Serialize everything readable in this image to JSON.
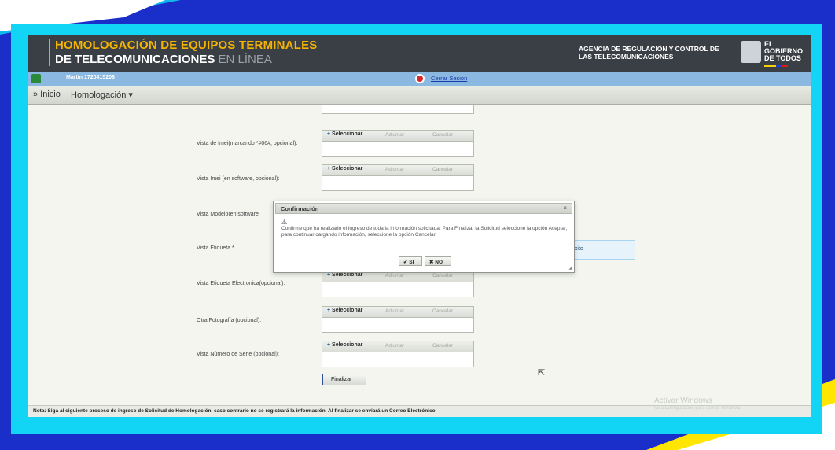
{
  "header": {
    "title_line1": "HOMOLOGACIÓN DE EQUIPOS TERMINALES",
    "title_line2_bold": "DE TELECOMUNICACIONES",
    "title_line2_light": "EN LÍNEA",
    "agency": "AGENCIA DE REGULACIÓN Y CONTROL DE LAS TELECOMUNICACIONES",
    "gov_line1": "EL",
    "gov_line2": "GOBIERNO",
    "gov_line3": "DE TODOS"
  },
  "userbar": {
    "user": "Martín 1720415208",
    "logout": "Cerrar Sesión"
  },
  "menu": [
    {
      "label": "» Inicio"
    },
    {
      "label": "Homologación ▾"
    }
  ],
  "upload_buttons": {
    "select": "Seleccionar",
    "attach": "Adjuntar",
    "cancel": "Cancelar"
  },
  "form_rows": [
    {
      "label": "Vista de Imei(marcando *#06#, opcional):"
    },
    {
      "label": "Vista Imei (en software, opcional):"
    },
    {
      "label": "Vista Modelo(en software"
    },
    {
      "label": "Vista Etiqueta *"
    },
    {
      "label": "Vista Etiqueta Electronica(opcional):"
    },
    {
      "label": "Otra Fotografía (opcional):"
    },
    {
      "label": "Vista Número de Serie (opcional):"
    }
  ],
  "success_message": "exito",
  "finalize_button": "Finalizar",
  "dialog": {
    "title": "Confirmación",
    "close": "×",
    "message": "Confirme que ha realizado el ingreso de toda la información solicitada. Para Finalizar la Solicitud seleccione la opción Aceptar, para continuar cargando información, seleccione la opción Cancelar",
    "yes": "✔ SI",
    "no": "✖ NO"
  },
  "note": "Nota: Siga al siguiente proceso de ingreso de Solicitud de Homologación, caso contrario no se registrará la información. Al finalizar se enviará un Correo Electrónico.",
  "watermark": {
    "line1": "Activar Windows",
    "line2": "Ve a Configuración para activar Windows."
  },
  "colors": {
    "outer_frame": "#1a2fc9",
    "cyan_frame": "#12d4f5",
    "banner": "#3a3f45",
    "title_accent": "#f5b400",
    "userbar": "#8ab8e0"
  }
}
